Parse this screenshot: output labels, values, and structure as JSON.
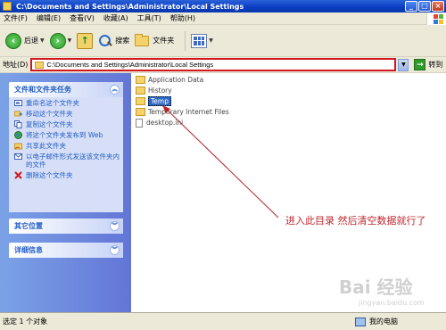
{
  "window": {
    "title": "C:\\Documents and Settings\\Administrator\\Local Settings"
  },
  "menu": [
    "文件(F)",
    "编辑(E)",
    "查看(V)",
    "收藏(A)",
    "工具(T)",
    "帮助(H)"
  ],
  "toolbar": {
    "back": "后退",
    "search": "搜索",
    "folders": "文件夹"
  },
  "address": {
    "label": "地址(D)",
    "path": "C:\\Documents and Settings\\Administrator\\Local Settings",
    "go": "转到"
  },
  "tasks": {
    "title": "文件和文件夹任务",
    "items": [
      "重命名这个文件夹",
      "移动这个文件夹",
      "复制这个文件夹",
      "将这个文件夹发布到 Web",
      "共享此文件夹",
      "以电子邮件形式发送该文件夹内的文件",
      "删除这个文件夹"
    ]
  },
  "other_places": {
    "title": "其它位置"
  },
  "details": {
    "title": "详细信息"
  },
  "files": [
    {
      "name": "Application Data",
      "type": "folder"
    },
    {
      "name": "History",
      "type": "folder"
    },
    {
      "name": "Temp",
      "type": "folder",
      "selected": true
    },
    {
      "name": "Temporary Internet Files",
      "type": "folder"
    },
    {
      "name": "desktop.ini",
      "type": "file"
    }
  ],
  "annotation": "进入此目录  然后清空数据就行了",
  "watermark": {
    "logo": "Bai 经验",
    "url": "jingyan.baidu.com"
  },
  "status": {
    "left": "选定 1 个对象",
    "right": "我的电脑"
  }
}
